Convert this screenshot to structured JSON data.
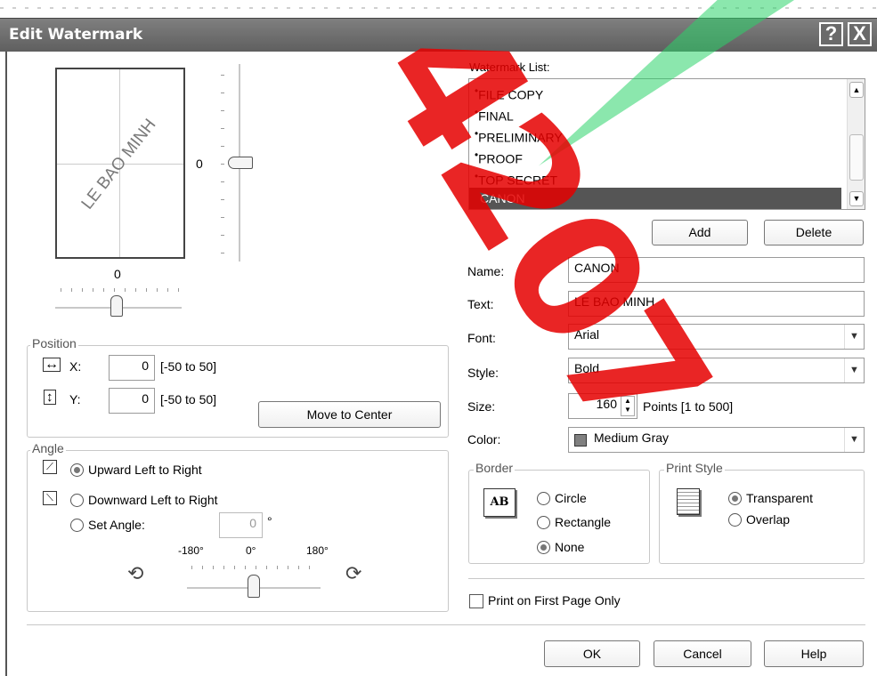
{
  "window": {
    "title": "Edit Watermark",
    "help_glyph": "?",
    "close_glyph": "X"
  },
  "preview": {
    "text": "LE BAO MINH",
    "vertical_value": "0",
    "horizontal_value": "0"
  },
  "position": {
    "group_label": "Position",
    "x_label": "X:",
    "x_value": "0",
    "x_range": "[-50 to 50]",
    "y_label": "Y:",
    "y_value": "0",
    "y_range": "[-50 to 50]",
    "move_to_center": "Move to Center"
  },
  "angle": {
    "group_label": "Angle",
    "upward": "Upward Left to Right",
    "downward": "Downward Left to Right",
    "set_angle": "Set Angle:",
    "set_angle_value": "0",
    "degree_sign": "°",
    "min_label": "-180°",
    "mid_label": "0°",
    "max_label": "180°",
    "selected": "upward"
  },
  "watermark_list": {
    "label": "Watermark List:",
    "items": [
      "FILE COPY",
      "FINAL",
      "PRELIMINARY",
      "PROOF",
      "TOP SECRET",
      "CANON"
    ],
    "selected": "CANON",
    "add": "Add",
    "delete": "Delete"
  },
  "fields": {
    "name_label": "Name:",
    "name_value": "CANON",
    "text_label": "Text:",
    "text_value": "LE BAO MINH",
    "font_label": "Font:",
    "font_value": "Arial",
    "style_label": "Style:",
    "style_value": "Bold",
    "size_label": "Size:",
    "size_value": "160",
    "size_hint": "Points [1 to 500]",
    "color_label": "Color:",
    "color_value": "Medium Gray",
    "color_swatch": "#808080"
  },
  "border": {
    "group_label": "Border",
    "icon_text": "AB",
    "circle": "Circle",
    "rectangle": "Rectangle",
    "none": "None",
    "selected": "none"
  },
  "print_style": {
    "group_label": "Print Style",
    "transparent": "Transparent",
    "overlap": "Overlap",
    "selected": "transparent"
  },
  "first_page_only": {
    "label": "Print on First Page Only",
    "checked": false
  },
  "footer": {
    "ok": "OK",
    "cancel": "Cancel",
    "help": "Help"
  },
  "overlay_stamp": {
    "text": "4207",
    "color": "#e60000"
  }
}
